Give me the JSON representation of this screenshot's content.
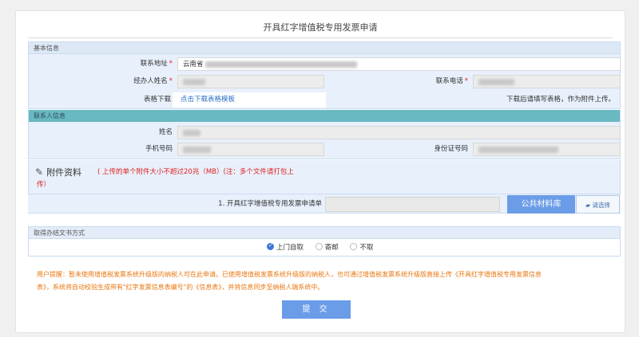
{
  "page": {
    "title": "开具红字增值税专用发票申请"
  },
  "basic": {
    "section_title": "基本信息",
    "address_label": "联系地址",
    "address_value": "云南省",
    "handler_label": "经办人姓名",
    "phone_label": "联系电话",
    "template_label": "表格下载",
    "template_link": "点击下载表格模板",
    "template_note": "下载后请填写表格，作为附件上传。"
  },
  "contact": {
    "section_title": "联系人信息",
    "name_label": "姓名",
    "mobile_label": "手机号码",
    "id_label": "身份证号码"
  },
  "attach": {
    "title": "附件资料",
    "note_line1": "( 上传的单个附件大小不超过20兆（MB）(注：多个文件请打包上",
    "note_line2": "传）",
    "file1_label": "1. 开具红字增值税专用发票申请单",
    "library_button": "公共材料库",
    "select_button": "请选择"
  },
  "pickup": {
    "section_title": "取得办结文书方式",
    "options": [
      "上门自取",
      "寄邮",
      "不取"
    ],
    "selected": "上门自取"
  },
  "hint": {
    "line1": "用户提醒：暂未使用增值税发票系统升级版的纳税人可在此申请。已使用增值税发票系统升级版的纳税人，也可通过增值税发票系统升级版直接上传《开具红字增值税专用发票信息",
    "line2": "表》，系统将自动校验生成带有\"红字发票信息表编号\"的《信息表》，并将信息同步至纳税人端系统中。"
  },
  "submit_label": "提 交"
}
